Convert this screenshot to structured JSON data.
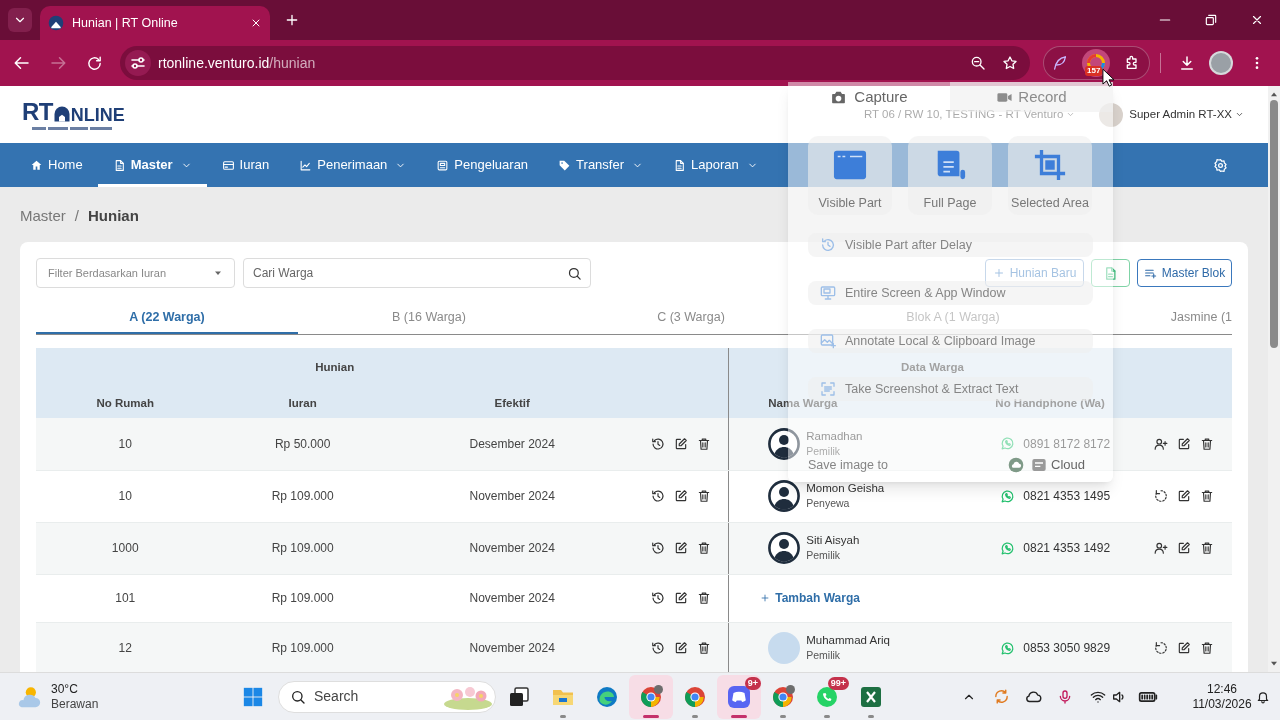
{
  "browser": {
    "tab_title": "Hunian | RT Online",
    "url_host": "rtonline.venturo.id",
    "url_path": "/hunian",
    "forward_disabled": true,
    "extension_badge": "157"
  },
  "header": {
    "logo_left": "RT",
    "logo_right": "NLINE",
    "location": "RT 06 / RW 10, TESTING - RT Venturo",
    "user": "Super Admin RT-XX"
  },
  "nav": {
    "items": [
      {
        "label": "Home",
        "selected": false,
        "dropdown": false
      },
      {
        "label": "Master",
        "selected": true,
        "dropdown": true
      },
      {
        "label": "Iuran",
        "selected": false,
        "dropdown": false
      },
      {
        "label": "Penerimaan",
        "selected": false,
        "dropdown": true
      },
      {
        "label": "Pengeluaran",
        "selected": false,
        "dropdown": false
      },
      {
        "label": "Transfer",
        "selected": false,
        "dropdown": true
      },
      {
        "label": "Laporan",
        "selected": false,
        "dropdown": true
      }
    ]
  },
  "breadcrumb": {
    "items": [
      "Master",
      "Hunian"
    ],
    "separator": "/"
  },
  "filters": {
    "iuran_select": {
      "placeholder": "Filter Berdasarkan Iuran"
    },
    "search": {
      "placeholder": "Cari Warga"
    }
  },
  "actions": [
    {
      "kind": "add",
      "label": "Hunian Baru"
    },
    {
      "kind": "export"
    },
    {
      "kind": "list",
      "label": "Master Blok"
    }
  ],
  "tabs": [
    {
      "label": "A (22 Warga)",
      "selected": true
    },
    {
      "label": "B (16 Warga)",
      "selected": false
    },
    {
      "label": "C (3 Warga)",
      "selected": false
    },
    {
      "label": "Blok A (1 Warga)",
      "selected": false
    },
    {
      "label": "Jasmine (1",
      "selected": false
    }
  ],
  "table": {
    "groups": [
      "Hunian",
      "Data Warga"
    ],
    "columns": [
      "No Rumah",
      "Iuran",
      "Efektif",
      "Nama Warga",
      "No Handphone (Wa)"
    ],
    "rows": [
      {
        "no_rumah": "10",
        "iuran": "Rp 50.000",
        "efektif": "Desember 2024",
        "warga": {
          "kind": "silhouette",
          "name": "Ramadhan",
          "role": "Pemilik",
          "phone": "0891 8172 8172",
          "action": {
            "kind": "add"
          }
        }
      },
      {
        "no_rumah": "10",
        "iuran": "Rp 109.000",
        "efektif": "November 2024",
        "warga": {
          "kind": "silhouette",
          "name": "Momon Geisha",
          "role": "Penyewa",
          "phone": "0821 4353 1495",
          "action": {
            "kind": "swap"
          }
        }
      },
      {
        "no_rumah": "1000",
        "iuran": "Rp 109.000",
        "efektif": "November 2024",
        "warga": {
          "kind": "silhouette",
          "name": "Siti Aisyah",
          "role": "Pemilik",
          "phone": "0821 4353 1492",
          "action": {
            "kind": "add"
          }
        }
      },
      {
        "no_rumah": "101",
        "iuran": "Rp 109.000",
        "efektif": "November 2024",
        "add_link": "Tambah Warga"
      },
      {
        "no_rumah": "12",
        "iuran": "Rp 109.000",
        "efektif": "November 2024",
        "warga": {
          "kind": "photo",
          "name": "Muhammad Ariq",
          "role": "Pemilik",
          "phone": "0853 3050 9829",
          "action": {
            "kind": "swap"
          }
        }
      }
    ]
  },
  "capture_popup": {
    "tabs": [
      {
        "label": "Capture",
        "selected": true
      },
      {
        "label": "Record",
        "selected": false
      }
    ],
    "modes": [
      "Visible Part",
      "Full Page",
      "Selected Area"
    ],
    "options": [
      "Visible Part after Delay",
      "Entire Screen & App Window",
      "Annotate Local & Clipboard Image",
      "Take Screenshot & Extract Text"
    ],
    "save_label": "Save image to",
    "save_target": "Cloud"
  },
  "taskbar": {
    "weather": {
      "temperature": "30°C",
      "condition": "Berawan"
    },
    "search": {
      "placeholder": "Search"
    },
    "apps": [
      {
        "running": false,
        "active": false
      },
      {
        "running": true,
        "active": false
      },
      {
        "running": false,
        "active": false
      },
      {
        "running": true,
        "active": true
      },
      {
        "running": true,
        "active": false
      },
      {
        "running": true,
        "active": true,
        "badge": "9+"
      },
      {
        "running": true,
        "active": false
      },
      {
        "running": true,
        "active": false,
        "badge": "99+"
      },
      {
        "running": true,
        "active": false
      }
    ],
    "clock": {
      "time": "12:46",
      "date": "11/03/2026"
    }
  }
}
